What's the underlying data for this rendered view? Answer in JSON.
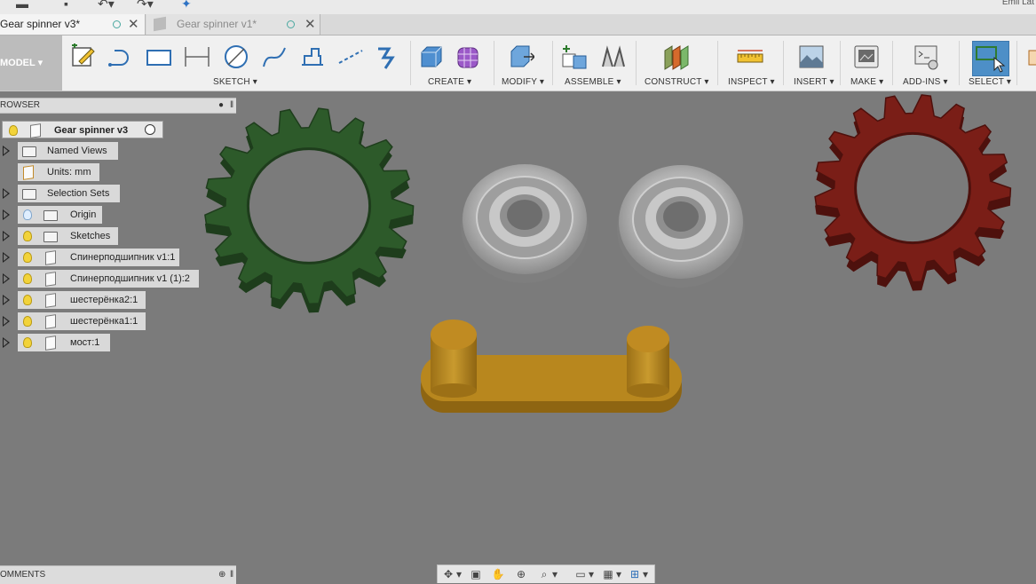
{
  "app": {
    "user_name": "Emil Lat"
  },
  "tabs": [
    {
      "label": "Gear spinner v3*",
      "active": true
    },
    {
      "label": "Gear spinner v1*",
      "active": false
    }
  ],
  "toolbar": {
    "workspace": "MODEL ▾",
    "groups": [
      {
        "label": "SKETCH ▾"
      },
      {
        "label": "CREATE ▾"
      },
      {
        "label": "MODIFY ▾"
      },
      {
        "label": "ASSEMBLE ▾"
      },
      {
        "label": "CONSTRUCT ▾"
      },
      {
        "label": "INSPECT ▾"
      },
      {
        "label": "INSERT ▾"
      },
      {
        "label": "MAKE ▾"
      },
      {
        "label": "ADD-INS ▾"
      },
      {
        "label": "SELECT ▾"
      }
    ],
    "select_active_color": "#4d8fc7"
  },
  "browser": {
    "title": "ROWSER",
    "root": {
      "label": "Gear spinner v3"
    },
    "items": [
      {
        "label": "Named Views",
        "icon": "folder-icon"
      },
      {
        "label": "Units: mm",
        "icon": "document-icon"
      },
      {
        "label": "Selection Sets",
        "icon": "folder-icon"
      },
      {
        "label": "Origin",
        "icon": "folder-icon"
      },
      {
        "label": "Sketches",
        "icon": "folder-icon"
      },
      {
        "label": "Спинерподшипник v1:1",
        "icon": "component-icon"
      },
      {
        "label": "Спинерподшипник v1 (1):2",
        "icon": "component-icon"
      },
      {
        "label": "шестерёнка2:1",
        "icon": "component-icon"
      },
      {
        "label": "шестерёнка1:1",
        "icon": "component-icon"
      },
      {
        "label": "мост:1",
        "icon": "component-icon"
      }
    ]
  },
  "comments": {
    "title": "OMMENTS"
  },
  "viewport": {
    "background": "#7b7b7b",
    "gear_green": "#2d5a2a",
    "gear_red": "#7a1e17",
    "bridge_color": "#b8871e",
    "bearing_color": "#b4b4b4"
  }
}
